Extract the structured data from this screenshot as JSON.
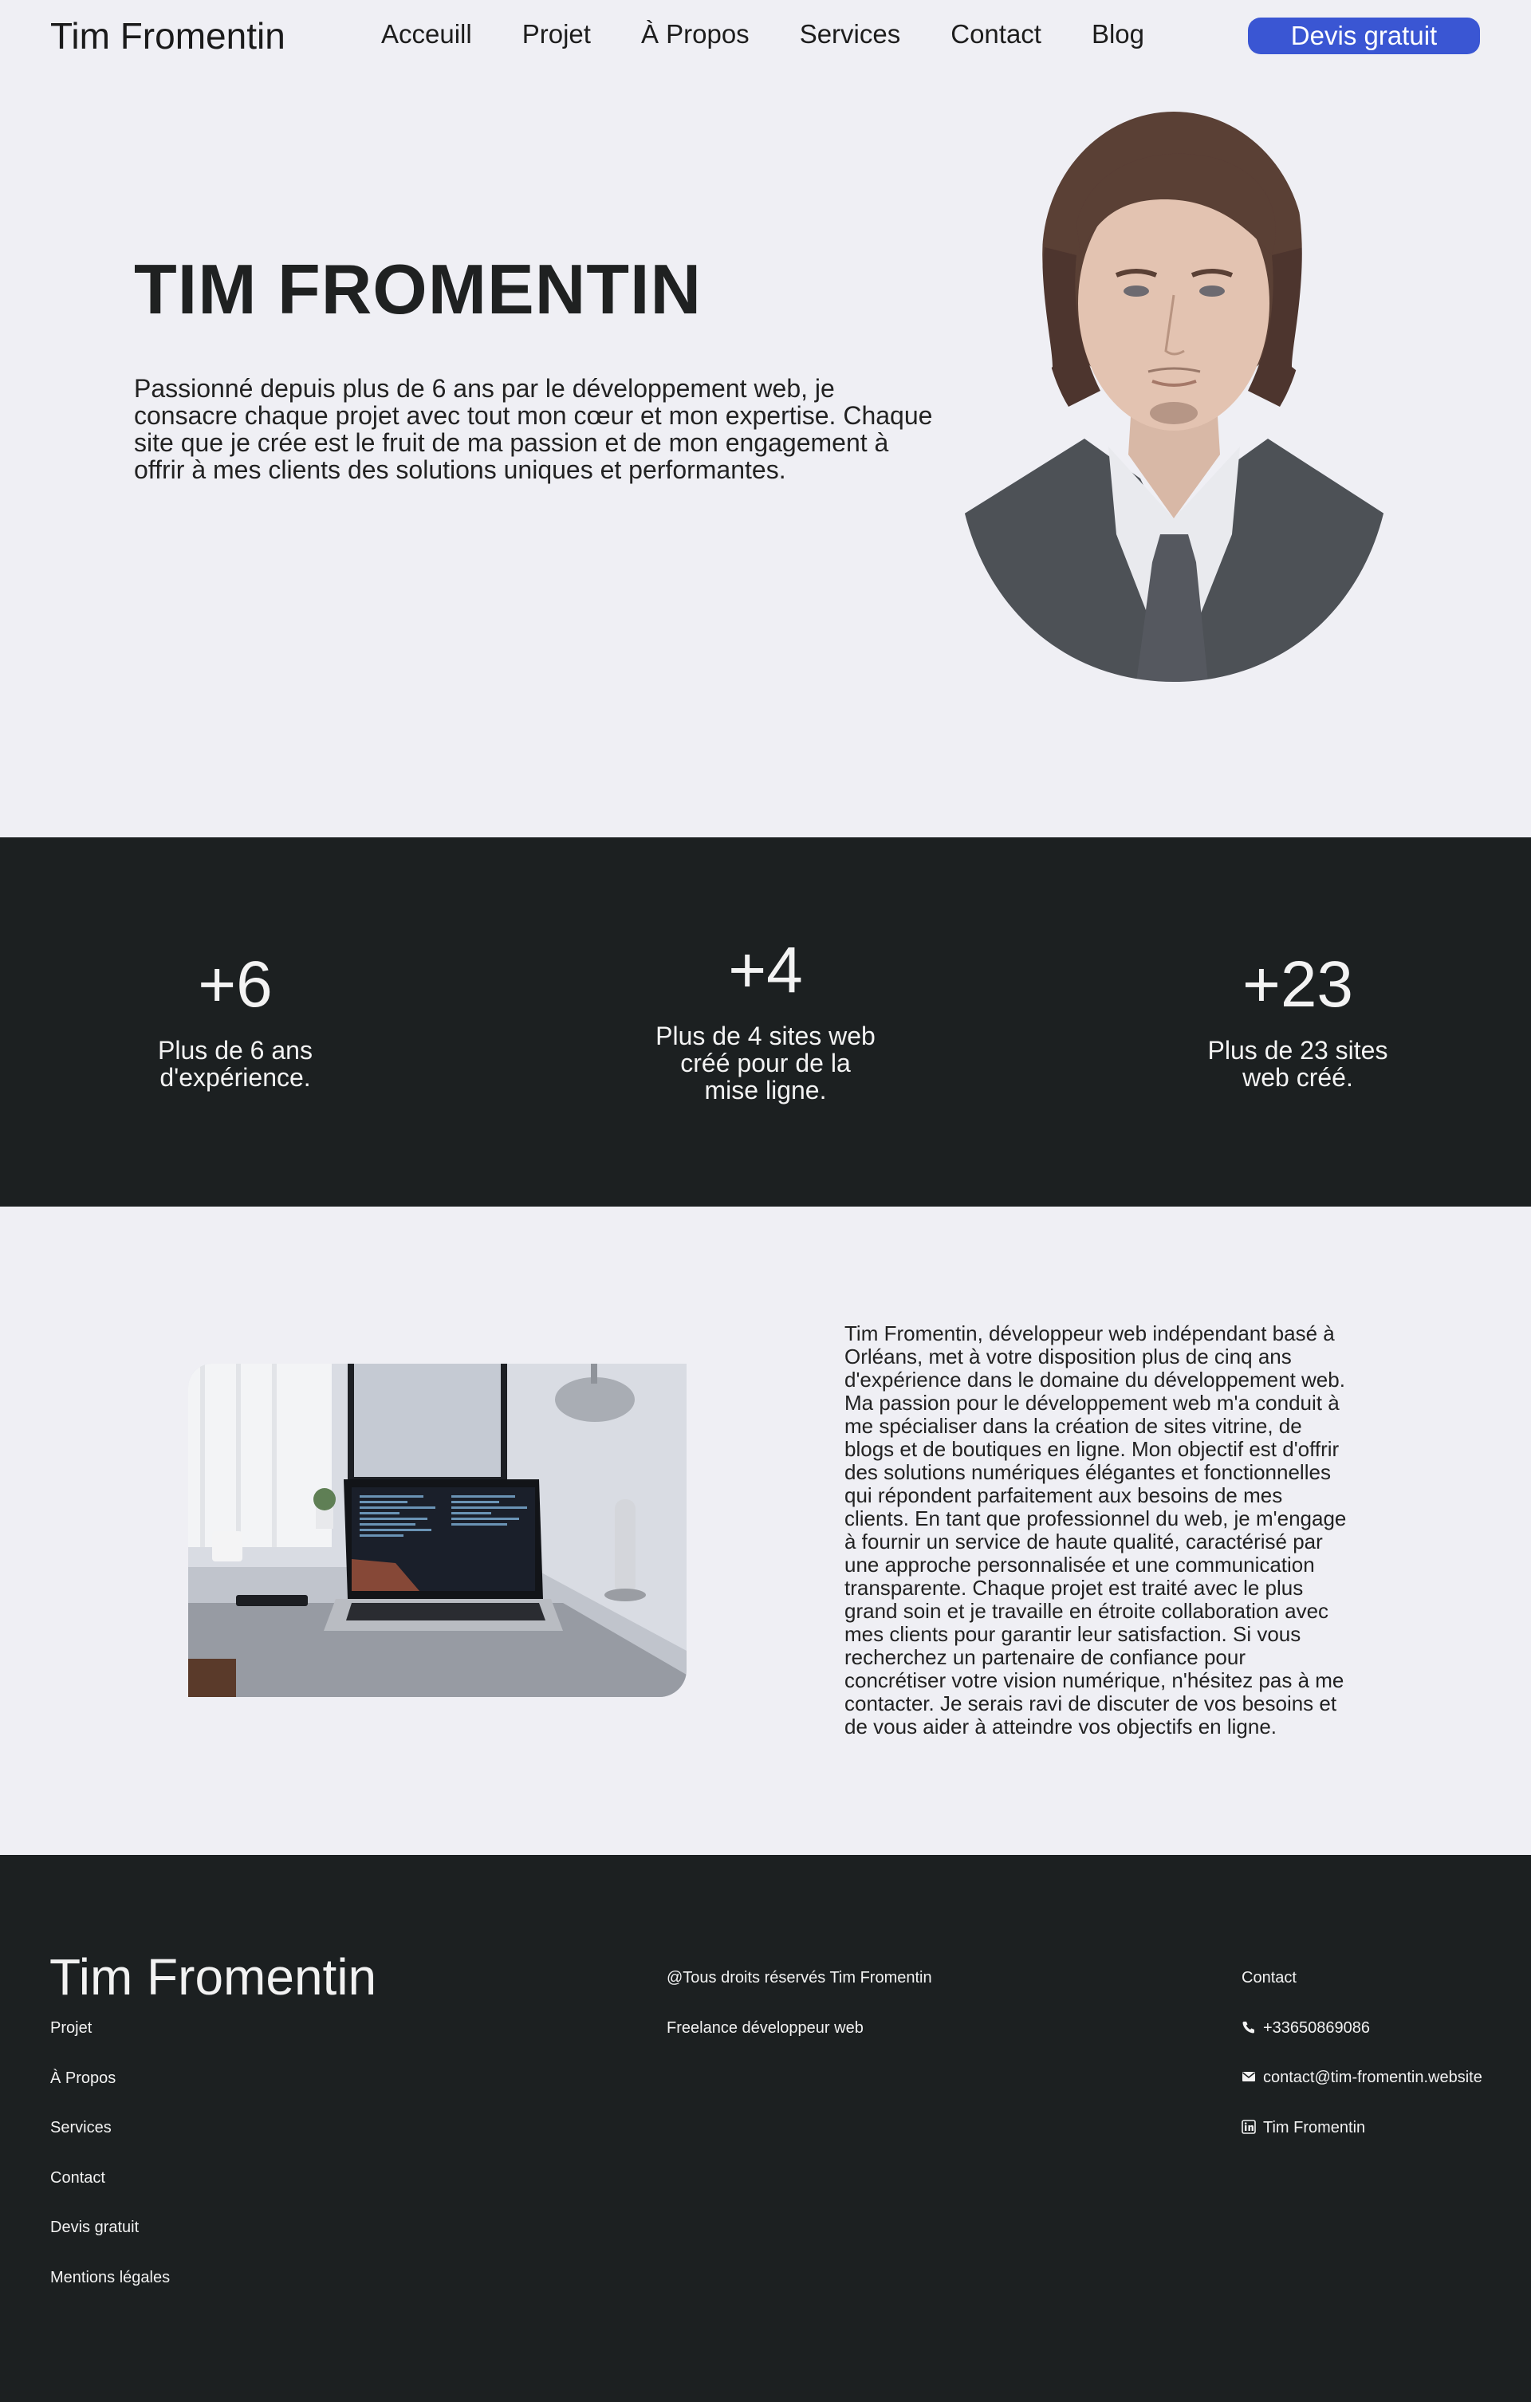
{
  "nav": {
    "brand": "Tim Fromentin",
    "links": [
      "Acceuill",
      "Projet",
      "À Propos",
      "Services",
      "Contact",
      "Blog"
    ],
    "cta": "Devis gratuit"
  },
  "hero": {
    "title": "TIM FROMENTIN",
    "text": "Passionné depuis plus de 6 ans par le développement web, je consacre chaque projet avec tout mon cœur et mon expertise. Chaque site que je crée est le fruit de ma passion et de mon engagement à offrir à mes clients des solutions uniques et performantes."
  },
  "stats": [
    {
      "num": "+6",
      "label": "Plus de 6 ans d'expérience."
    },
    {
      "num": "+4",
      "label": "Plus de 4 sites web créé pour de la mise ligne."
    },
    {
      "num": "+23",
      "label": "Plus de 23 sites web créé."
    }
  ],
  "about": {
    "text": "Tim Fromentin, développeur web indépendant basé à Orléans, met à votre disposition plus de cinq ans d'expérience dans le domaine du développement web. Ma passion pour le développement web m'a conduit à me spécialiser dans la création de sites vitrine, de blogs et de boutiques en ligne. Mon objectif est d'offrir des solutions numériques élégantes et fonctionnelles qui répondent parfaitement aux besoins de mes clients. En tant que professionnel du web, je m'engage à fournir un service de haute qualité, caractérisé par une approche personnalisée et une communication transparente. Chaque projet est traité avec le plus grand soin et je travaille en étroite collaboration avec mes clients pour garantir leur satisfaction. Si vous recherchez un partenaire de confiance pour concrétiser votre vision numérique, n'hésitez pas à me contacter. Je serais ravi de discuter de vos besoins et de vous aider à atteindre vos objectifs en ligne."
  },
  "footer": {
    "brand": "Tim Fromentin",
    "links": [
      "Projet",
      "À Propos",
      "Services",
      "Contact",
      "Devis gratuit",
      "Mentions légales"
    ],
    "copyright": "@Tous droits réservés Tim Fromentin",
    "tagline": "Freelance développeur web",
    "contact_title": "Contact",
    "phone": "+33650869086",
    "email": "contact@tim-fromentin.website",
    "linkedin": "Tim Fromentin",
    "icons": {
      "phone": "phone-icon",
      "email": "mail-icon",
      "linkedin": "linkedin-icon"
    }
  },
  "colors": {
    "accent": "#3a56d3",
    "dark": "#1c2021",
    "background": "#efeff4"
  }
}
